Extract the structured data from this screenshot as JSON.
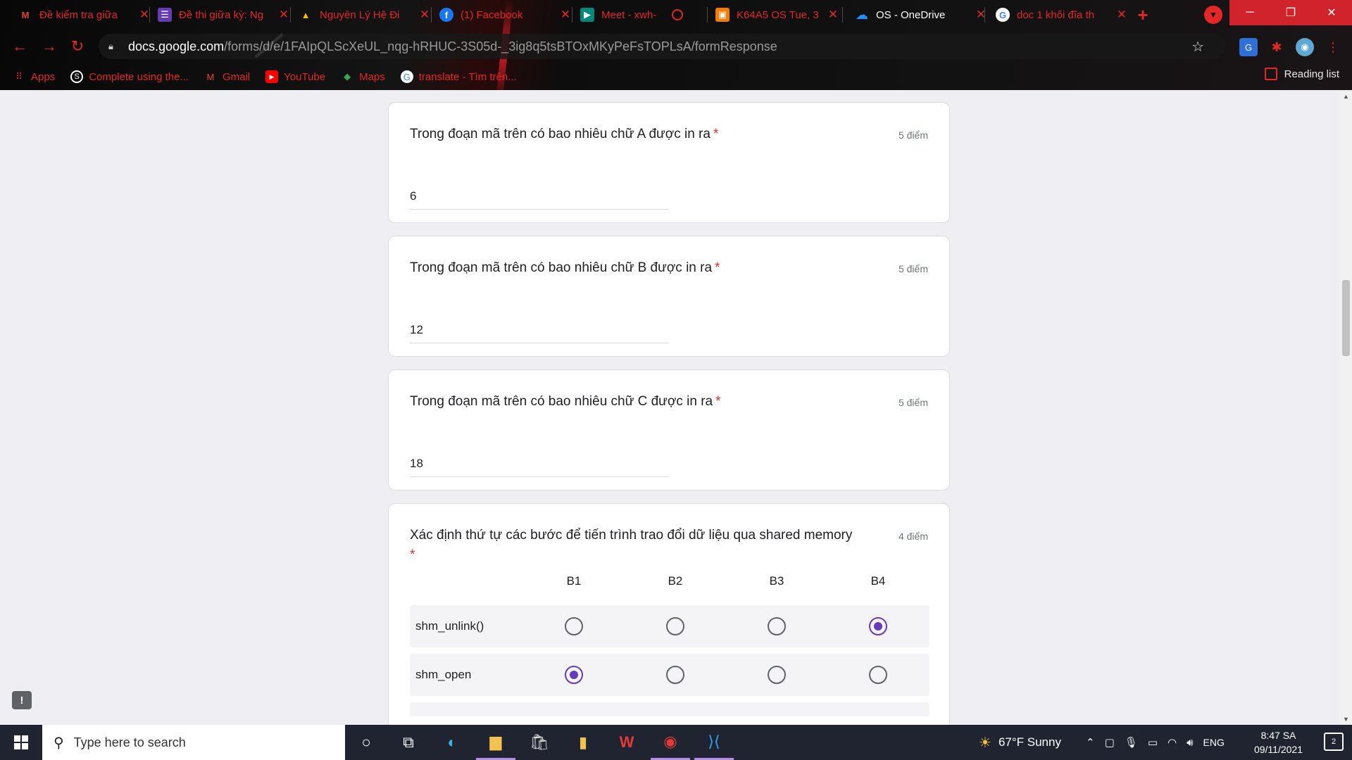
{
  "tabs": [
    {
      "title": "Đề kiểm tra giữa",
      "icon": "gmail-icon",
      "color": "#ea4335",
      "glyph": "M"
    },
    {
      "title": "Đề thi giữa kỳ: Ng",
      "icon": "forms-icon",
      "color": "#673ab7",
      "glyph": "☰"
    },
    {
      "title": "Nguyên Lý Hệ Đi",
      "icon": "drive-icon",
      "color": "#34a853",
      "glyph": "▲"
    },
    {
      "title": "(1) Facebook",
      "icon": "facebook-icon",
      "color": "#1877f2",
      "glyph": "f"
    },
    {
      "title": "Meet - xwh-",
      "icon": "meet-icon",
      "color": "#00897b",
      "glyph": "▶"
    },
    {
      "title": "K64A5 OS Tue, 3",
      "icon": "classroom-icon",
      "color": "#f57c00",
      "glyph": "▣"
    },
    {
      "title": "OS - OneDrive",
      "icon": "onedrive-icon",
      "color": "#0078d4",
      "glyph": "☁"
    },
    {
      "title": "doc 1 khối đĩa th",
      "icon": "google-icon",
      "color": "#ffffff",
      "glyph": "G"
    }
  ],
  "address": {
    "host": "docs.google.com",
    "path": "/forms/d/e/1FAIpQLScXeUL_nqg-hRHUC-3S05d-_3ig8q5tsBTOxMKyPeFsTOPLsA/formResponse"
  },
  "bookmarks": [
    {
      "label": "Apps",
      "icon": "apps-grid-icon",
      "color": "#e32626",
      "glyph": "⋮⋮"
    },
    {
      "label": "Complete using the...",
      "icon": "skype-icon",
      "color": "#333333",
      "glyph": "S"
    },
    {
      "label": "Gmail",
      "icon": "gmail-icon",
      "color": "#ea4335",
      "glyph": "M"
    },
    {
      "label": "YouTube",
      "icon": "youtube-icon",
      "color": "#ff0000",
      "glyph": "▶"
    },
    {
      "label": "Maps",
      "icon": "maps-icon",
      "color": "#34a853",
      "glyph": "◆"
    },
    {
      "label": "translate - Tìm trên...",
      "icon": "google-icon",
      "color": "#ffffff",
      "glyph": "G"
    }
  ],
  "reading_list": "Reading list",
  "questions": [
    {
      "title": "Trong đoạn mã trên có bao nhiêu chữ A được in ra",
      "required": "*",
      "points": "5 điểm",
      "answer": "6"
    },
    {
      "title": "Trong đoạn mã trên có bao nhiêu chữ B được in ra",
      "required": "*",
      "points": "5 điểm",
      "answer": "12"
    },
    {
      "title": "Trong đoạn mã trên có bao nhiêu chữ C được in ra",
      "required": "*",
      "points": "5 điểm",
      "answer": "18"
    }
  ],
  "grid_question": {
    "title": "Xác định thứ tự các bước để tiến trình trao đổi dữ liệu qua shared memory",
    "required": "*",
    "points": "4 điểm",
    "columns": [
      "B1",
      "B2",
      "B3",
      "B4"
    ],
    "rows": [
      {
        "label": "shm_unlink()",
        "selected": "B4"
      },
      {
        "label": "shm_open",
        "selected": "B1"
      }
    ]
  },
  "taskbar": {
    "search_placeholder": "Type here to search",
    "weather": "67°F  Sunny",
    "language": "ENG",
    "time": "8:47 SA",
    "date": "09/11/2021",
    "notifications": "2"
  },
  "colors": {
    "accent": "#673ab7",
    "required": "#d93025",
    "tab_text": "#e32626"
  }
}
